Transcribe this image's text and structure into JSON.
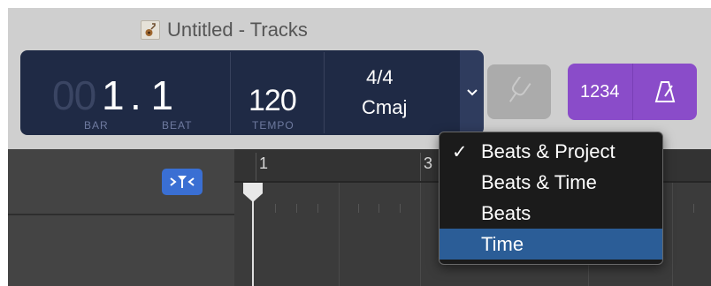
{
  "window": {
    "title": "Untitled - Tracks"
  },
  "lcd": {
    "bar_dim": "00",
    "bar_value": "1",
    "beat_value": ". 1",
    "bar_caption": "BAR",
    "beat_caption": "BEAT",
    "tempo_value": "120",
    "tempo_caption": "TEMPO",
    "signature": "4/4",
    "key": "Cmaj"
  },
  "controls": {
    "count_in_label": "1234"
  },
  "ruler": {
    "bar_numbers": [
      "1",
      "3"
    ]
  },
  "display_menu": {
    "items": [
      {
        "label": "Beats & Project",
        "checked": true,
        "highlighted": false
      },
      {
        "label": "Beats & Time",
        "checked": false,
        "highlighted": false
      },
      {
        "label": "Beats",
        "checked": false,
        "highlighted": false
      },
      {
        "label": "Time",
        "checked": false,
        "highlighted": true
      }
    ],
    "check_glyph": "✓"
  },
  "colors": {
    "lcd_bg": "#1f2a45",
    "accent_purple": "#8a4cc9",
    "cycle_blue": "#3a6fd3",
    "menu_highlight": "#2b5d97"
  }
}
